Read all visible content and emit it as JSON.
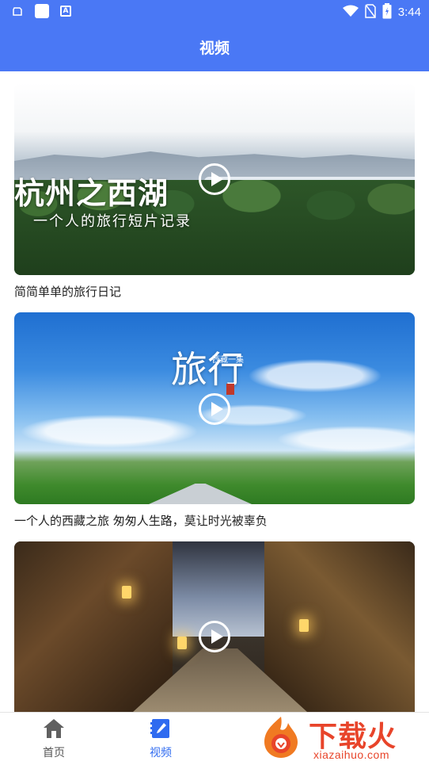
{
  "status_bar": {
    "time": "3:44",
    "left_icons": [
      "notification-icon",
      "app-icon",
      "a-icon"
    ],
    "right_icons": [
      "wifi-icon",
      "no-sim-icon",
      "battery-icon"
    ]
  },
  "app_bar": {
    "title": "视频"
  },
  "videos": [
    {
      "caption": "简简单单的旅行日记",
      "thumb_title": "杭州之西湖",
      "thumb_subtitle": "一个人的旅行短片记录"
    },
    {
      "caption": "一个人的西藏之旅 匆匆人生路，莫让时光被辜负",
      "thumb_title": "旅行",
      "thumb_subtitle": "西藏一集"
    },
    {
      "caption": "",
      "thumb_title": "",
      "thumb_subtitle": ""
    }
  ],
  "bottom_nav": {
    "items": [
      {
        "label": "首页",
        "icon": "home-icon",
        "active": false
      },
      {
        "label": "视频",
        "icon": "video-note-icon",
        "active": true
      }
    ]
  },
  "watermark": {
    "text": "下载火",
    "subtext": "xiazaihuo.com"
  },
  "colors": {
    "primary": "#4a78f5",
    "active_tab": "#2f6bf0",
    "watermark": "#e8442a"
  }
}
